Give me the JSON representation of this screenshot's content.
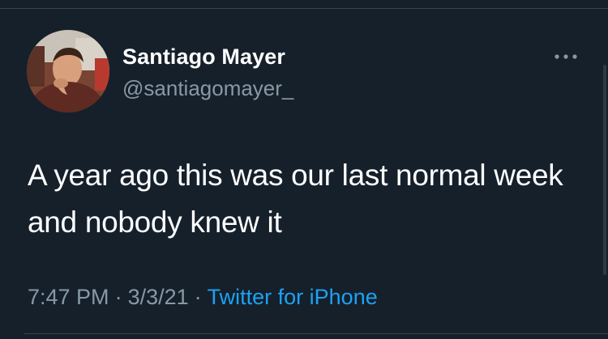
{
  "tweet": {
    "author": {
      "display_name": "Santiago Mayer",
      "handle": "@santiagomayer_",
      "avatar_icon": "user-photo"
    },
    "text": "A year ago this was our last normal week and nobody knew it",
    "time": "7:47 PM",
    "date": "3/3/21",
    "separator": "·",
    "source": "Twitter for iPhone",
    "more_icon": "more-horizontal-icon"
  },
  "colors": {
    "background": "#15202b",
    "primary_text": "#ffffff",
    "secondary_text": "#8899a6",
    "link": "#1da1f2",
    "divider": "#38444d"
  }
}
